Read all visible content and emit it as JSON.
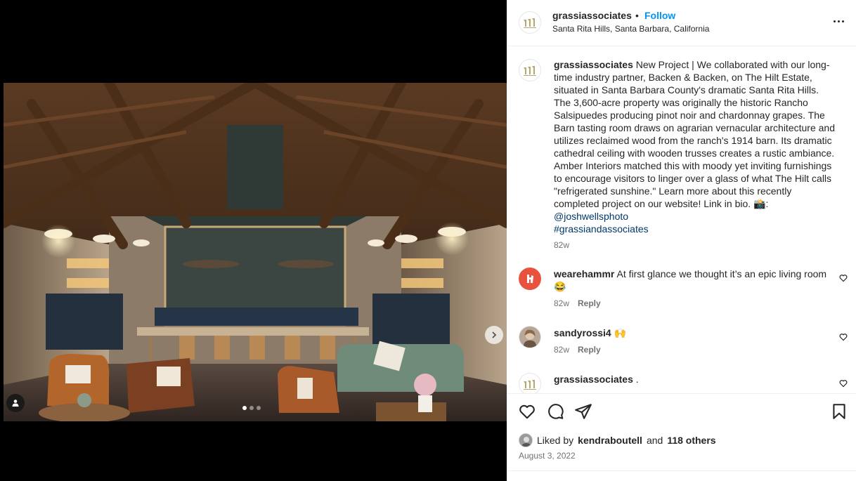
{
  "post": {
    "username": "grassiassociates",
    "separator": "•",
    "follow_label": "Follow",
    "location": "Santa Rita Hills, Santa Barbara, California"
  },
  "caption": {
    "username": "grassiassociates",
    "text": "New Project | We collaborated with our long-time industry partner, Backen & Backen, on The Hilt Estate, situated in Santa Barbara County's dramatic Santa Rita Hills. The 3,600-acre property was originally the historic Rancho Salsipuedes producing pinot noir and chardonnay grapes. The Barn tasting room draws on agrarian vernacular architecture and utilizes reclaimed wood from the ranch's 1914 barn. Its dramatic cathedral ceiling with wooden trusses creates a rustic ambiance. Amber Interiors matched this with moody yet inviting furnishings to encourage visitors to linger over a glass of what The Hilt calls \"refrigerated sunshine.\" Learn more about this recently completed project on our website! Link in bio. 📸:",
    "mention": "@joshwellsphoto",
    "hashtag": "#grassiandassociates",
    "age": "82w"
  },
  "comments": [
    {
      "username": "wearehammr",
      "text": "At first glance we thought it’s an epic living room 😂",
      "age": "82w",
      "reply_label": "Reply"
    },
    {
      "username": "sandyrossi4",
      "text": "🙌",
      "age": "82w",
      "reply_label": "Reply"
    },
    {
      "username": "grassiassociates",
      "text": "."
    }
  ],
  "likes": {
    "prefix": "Liked by",
    "user": "kendraboutell",
    "and": "and",
    "others": "118 others"
  },
  "date": "August 3, 2022",
  "carousel": {
    "current": 1,
    "total": 3
  },
  "icons": {
    "like": "heart-icon",
    "comment": "comment-icon",
    "share": "share-icon",
    "save": "bookmark-icon",
    "next": "chevron-right-icon",
    "tag": "user-tag-icon",
    "more": "more-options-icon"
  },
  "colors": {
    "follow": "#0095f6",
    "link": "#00376b",
    "muted": "#737373",
    "hammr_brand": "#e8533f",
    "logo_gold": "#b7a870"
  }
}
